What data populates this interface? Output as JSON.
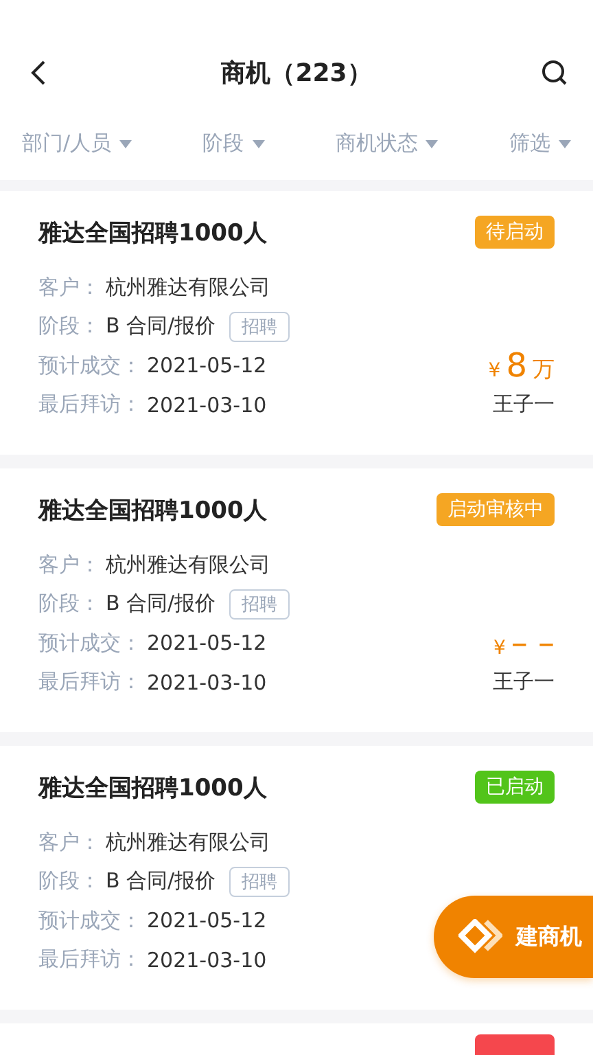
{
  "header": {
    "title": "商机（223）"
  },
  "filters": [
    {
      "label": "部门/人员"
    },
    {
      "label": "阶段"
    },
    {
      "label": "商机状态"
    },
    {
      "label": "筛选"
    }
  ],
  "cards": [
    {
      "title": "雅达全国招聘1000人",
      "status": "待启动",
      "color": "#f5a623",
      "customer_label": "客户：",
      "customer": "杭州雅达有限公司",
      "stage_label": "阶段：",
      "stage": "B 合同/报价",
      "tag": "招聘",
      "deal_label": "预计成交：",
      "deal_date": "2021-05-12",
      "visit_label": "最后拜访：",
      "visit_date": "2021-03-10",
      "amount": {
        "currency": "¥",
        "value": "8",
        "unit": "万"
      },
      "owner": "王子一"
    },
    {
      "title": "雅达全国招聘1000人",
      "status": "启动审核中",
      "color": "#f5a623",
      "customer_label": "客户：",
      "customer": "杭州雅达有限公司",
      "stage_label": "阶段：",
      "stage": "B 合同/报价",
      "tag": "招聘",
      "deal_label": "预计成交：",
      "deal_date": "2021-05-12",
      "visit_label": "最后拜访：",
      "visit_date": "2021-03-10",
      "amount": {
        "currency": "¥",
        "value": "– –"
      },
      "owner": "王子一"
    },
    {
      "title": "雅达全国招聘1000人",
      "status": "已启动",
      "color": "#52c41a",
      "customer_label": "客户：",
      "customer": "杭州雅达有限公司",
      "stage_label": "阶段：",
      "stage": "B 合同/报价",
      "tag": "招聘",
      "deal_label": "预计成交：",
      "deal_date": "2021-05-12",
      "visit_label": "最后拜访：",
      "visit_date": "2021-03-10"
    },
    {
      "color": "#f5474d"
    }
  ],
  "fab": {
    "label": "建商机"
  }
}
